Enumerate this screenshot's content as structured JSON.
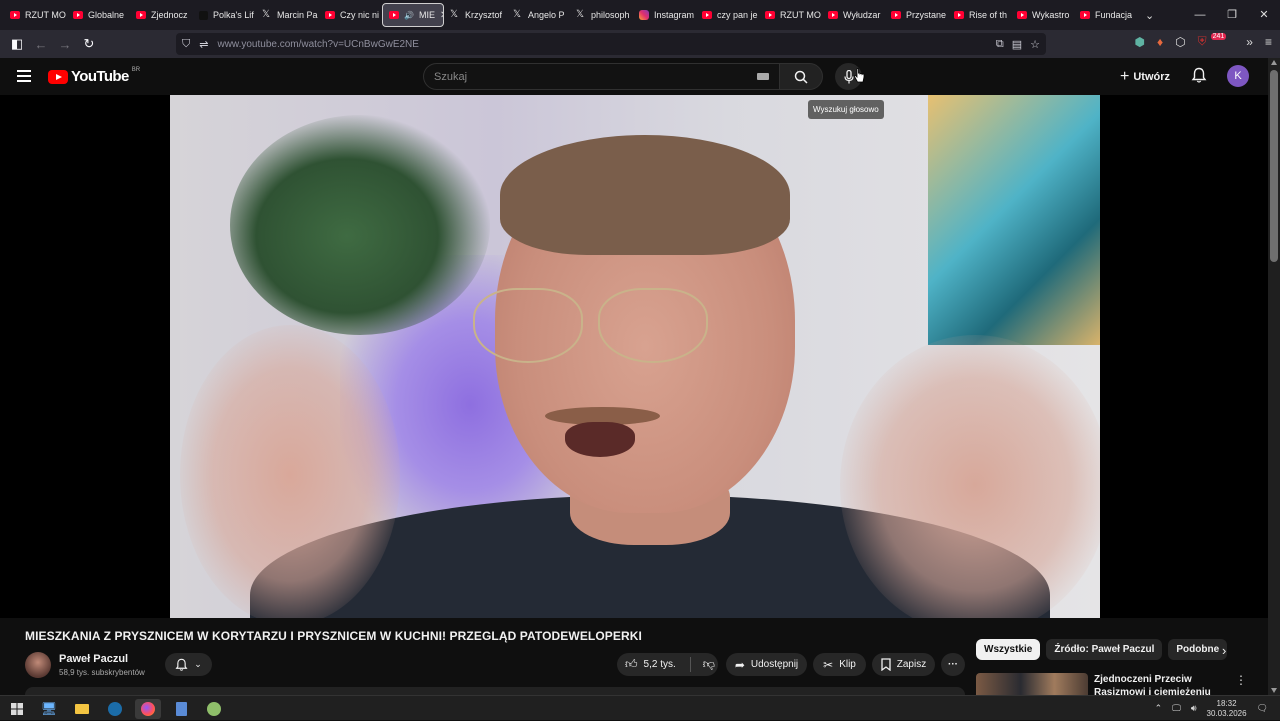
{
  "browser": {
    "tabs": [
      {
        "label": "RZUT MO",
        "icon": "youtube-icon"
      },
      {
        "label": "Globalne",
        "icon": "youtube-icon"
      },
      {
        "label": "Zjednocz",
        "icon": "youtube-icon"
      },
      {
        "label": "Polka's Lif",
        "icon": "tiktok-icon"
      },
      {
        "label": "Marcin Pa",
        "icon": "x-icon"
      },
      {
        "label": "Czy nic ni",
        "icon": "youtube-icon"
      },
      {
        "label": "MIE",
        "icon": "youtube-icon",
        "active": true
      },
      {
        "label": "Krzysztof",
        "icon": "x-icon"
      },
      {
        "label": "Angelo P",
        "icon": "x-icon"
      },
      {
        "label": "philosoph",
        "icon": "x-icon"
      },
      {
        "label": "Instagram",
        "icon": "instagram-icon"
      },
      {
        "label": "czy pan je",
        "icon": "youtube-icon"
      },
      {
        "label": "RZUT MO",
        "icon": "youtube-icon"
      },
      {
        "label": "Wyłudzar",
        "icon": "youtube-icon"
      },
      {
        "label": "Przystane",
        "icon": "youtube-icon"
      },
      {
        "label": "Rise of th",
        "icon": "youtube-icon"
      },
      {
        "label": "Wykastro",
        "icon": "youtube-icon"
      },
      {
        "label": "Fundacja",
        "icon": "youtube-icon"
      }
    ],
    "url": "www.youtube.com/watch?v=UCnBwGwE2NE",
    "extension_badge": "241"
  },
  "youtube": {
    "logo_text": "YouTube",
    "logo_country": "BR",
    "search_placeholder": "Szukaj",
    "voice_tooltip": "Wyszukuj głosowo",
    "create_label": "Utwórz",
    "avatar_letter": "K",
    "video_title": "MIESZKANIA Z PRYSZNICEM W KORYTARZU I PRYSZNICEM W KUCHNI! PRZEGLĄD PATODEWELOPERKI",
    "channel_name": "Paweł Paczul",
    "channel_subs": "58,9 tys. subskrybentów",
    "like_count": "5,2 tys.",
    "share_label": "Udostępnij",
    "clip_label": "Klip",
    "save_label": "Zapisz",
    "chips": [
      {
        "label": "Wszystkie",
        "active": true
      },
      {
        "label": "Źródło: Paweł Paczul"
      },
      {
        "label": "Podobne"
      }
    ],
    "recommended_title": "Zjednoczeni Przeciw Rasizmowi i ciemiężeniu"
  },
  "taskbar": {
    "time": "18:32",
    "date": "30.03.2026"
  },
  "colors": {
    "yt_red": "#ff0000",
    "avatar_purple": "#7e57c2",
    "background": "#0f0f0f"
  }
}
